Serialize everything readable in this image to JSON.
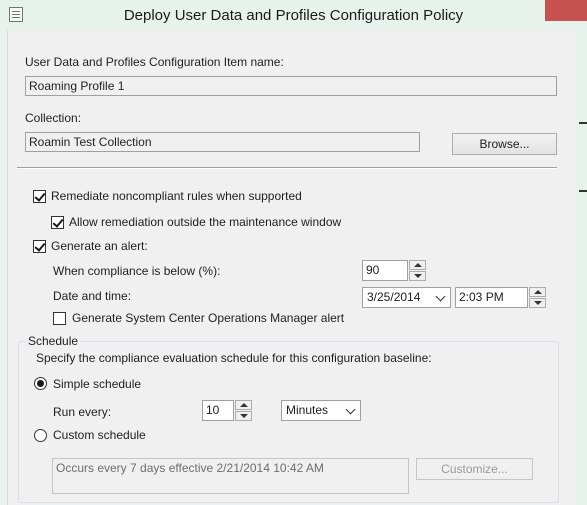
{
  "window": {
    "title": "Deploy User Data and Profiles Configuration Policy"
  },
  "item_name": {
    "label": "User Data and Profiles Configuration Item name:",
    "value": "Roaming Profile 1"
  },
  "collection": {
    "label": "Collection:",
    "value": "Roamin Test Collection",
    "browse_label": "Browse..."
  },
  "options": {
    "remediate": {
      "label": "Remediate noncompliant rules when supported",
      "checked": true
    },
    "allow_outside": {
      "label": "Allow remediation outside the maintenance window",
      "checked": true
    },
    "generate_alert": {
      "label": "Generate an alert:",
      "checked": true
    },
    "compliance_below": {
      "label": "When compliance is below (%):",
      "value": "90"
    },
    "date_time": {
      "label": "Date and time:",
      "date": "3/25/2014",
      "time": "2:03 PM"
    },
    "scom_alert": {
      "label": "Generate System Center Operations Manager alert",
      "checked": false
    }
  },
  "schedule": {
    "legend": "Schedule",
    "description": "Specify the compliance evaluation schedule for this configuration baseline:",
    "simple_label": "Simple schedule",
    "simple_selected": true,
    "run_every_label": "Run every:",
    "run_every_value": "10",
    "unit": "Minutes",
    "custom_label": "Custom schedule",
    "custom_summary": "Occurs every 7 days effective 2/21/2014 10:42 AM",
    "customize_label": "Customize..."
  },
  "colors": {
    "frame": "#e8f2ec",
    "close": "#c75050",
    "client": "#f0f0f0"
  }
}
